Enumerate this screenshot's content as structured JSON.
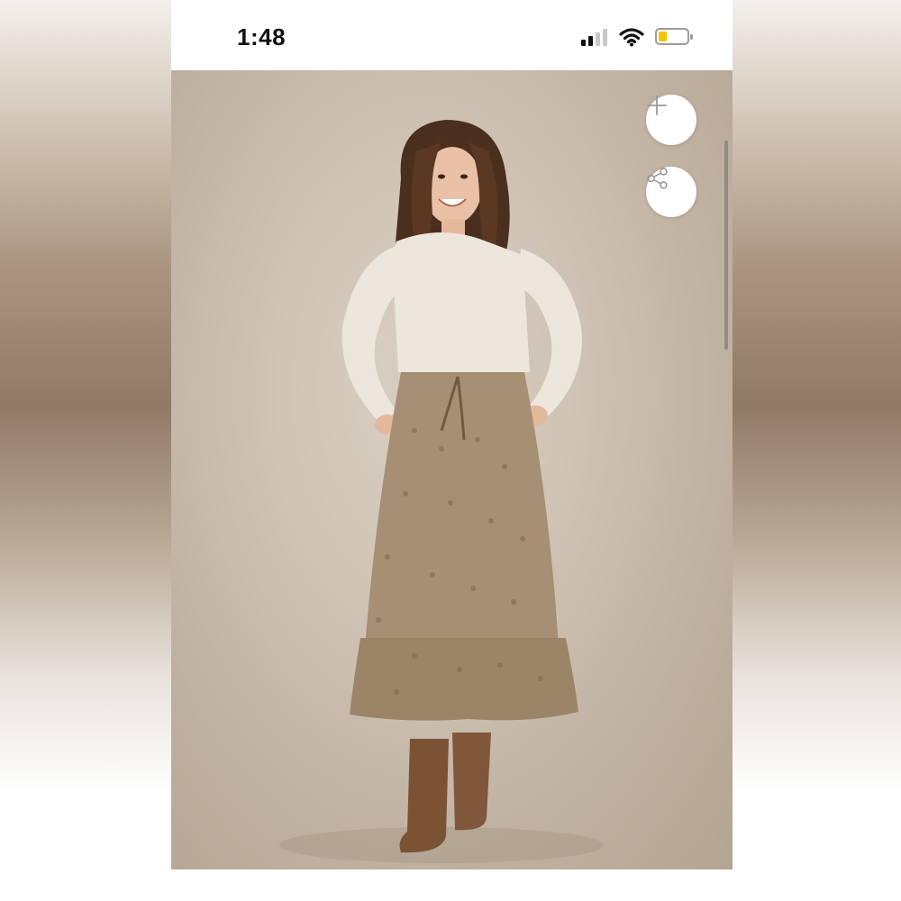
{
  "status_bar": {
    "time": "1:48",
    "signal_bars_active": 2,
    "signal_bars_total": 4,
    "battery_level": 0.3,
    "battery_color": "#f5c400"
  },
  "actions": {
    "add_icon": "plus-icon",
    "share_icon": "share-icon"
  },
  "photo": {
    "subject_icon": "product-photo"
  },
  "colors": {
    "background": "#ffffff",
    "photo_backdrop": "#cfc3b5",
    "icon_gray": "#9a9a9a"
  }
}
